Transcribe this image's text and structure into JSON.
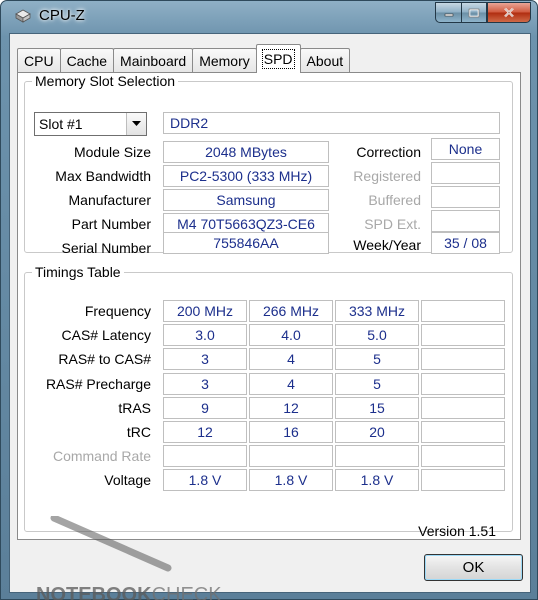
{
  "window": {
    "title": "CPU-Z"
  },
  "tabs": [
    {
      "label": "CPU"
    },
    {
      "label": "Cache"
    },
    {
      "label": "Mainboard"
    },
    {
      "label": "Memory"
    },
    {
      "label": "SPD"
    },
    {
      "label": "About"
    }
  ],
  "active_tab": "SPD",
  "memory_slot": {
    "group_title": "Memory Slot Selection",
    "selected_slot": "Slot #1",
    "memory_type": "DDR2",
    "labels": {
      "module_size": "Module Size",
      "max_bandwidth": "Max Bandwidth",
      "manufacturer": "Manufacturer",
      "part_number": "Part Number",
      "serial_number": "Serial Number",
      "correction": "Correction",
      "registered": "Registered",
      "buffered": "Buffered",
      "spd_ext": "SPD Ext.",
      "week_year": "Week/Year"
    },
    "values": {
      "module_size": "2048 MBytes",
      "max_bandwidth": "PC2-5300 (333 MHz)",
      "manufacturer": "Samsung",
      "part_number": "M4 70T5663QZ3-CE6",
      "serial_number": "755846AA",
      "correction": "None",
      "registered": "",
      "buffered": "",
      "spd_ext": "",
      "week_year": "35 / 08"
    }
  },
  "timings": {
    "group_title": "Timings Table",
    "rows": [
      {
        "label": "Frequency",
        "dim": false,
        "cells": [
          "200 MHz",
          "266 MHz",
          "333 MHz",
          ""
        ]
      },
      {
        "label": "CAS# Latency",
        "dim": false,
        "cells": [
          "3.0",
          "4.0",
          "5.0",
          ""
        ]
      },
      {
        "label": "RAS# to CAS#",
        "dim": false,
        "cells": [
          "3",
          "4",
          "5",
          ""
        ]
      },
      {
        "label": "RAS# Precharge",
        "dim": false,
        "cells": [
          "3",
          "4",
          "5",
          ""
        ]
      },
      {
        "label": "tRAS",
        "dim": false,
        "cells": [
          "9",
          "12",
          "15",
          ""
        ]
      },
      {
        "label": "tRC",
        "dim": false,
        "cells": [
          "12",
          "16",
          "20",
          ""
        ]
      },
      {
        "label": "Command Rate",
        "dim": true,
        "cells": [
          "",
          "",
          "",
          ""
        ]
      },
      {
        "label": "Voltage",
        "dim": false,
        "cells": [
          "1.8 V",
          "1.8 V",
          "1.8 V",
          ""
        ]
      }
    ]
  },
  "footer": {
    "version": "Version 1.51",
    "ok_label": "OK"
  },
  "watermark": {
    "text_bold": "NOTEBOOK",
    "text_light": "CHECK"
  },
  "colors": {
    "value_text": "#1c2f8c",
    "dim_label": "#a8a8a8",
    "frame": "#5b7f99"
  }
}
